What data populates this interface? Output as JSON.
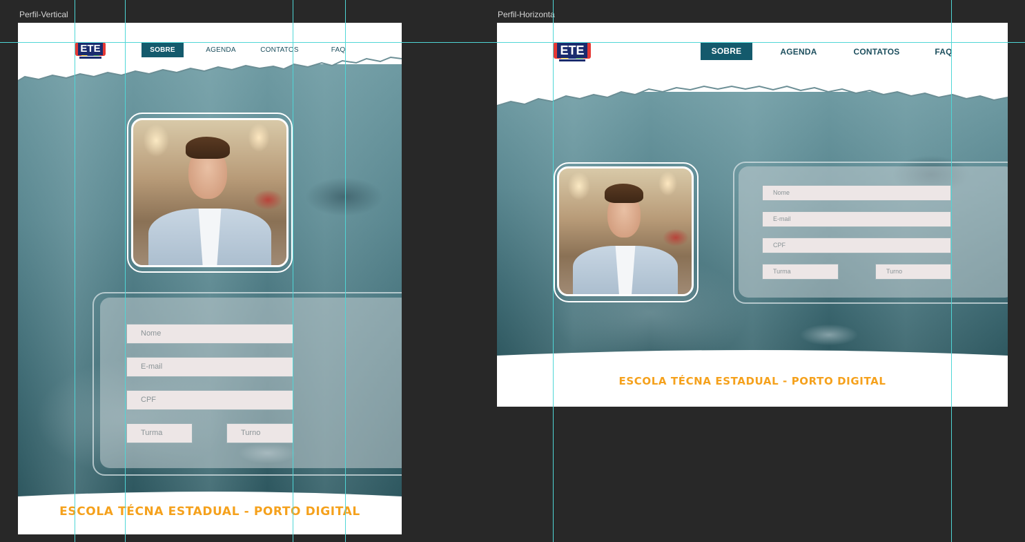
{
  "artboards": {
    "vertical": {
      "name": "Perfil-Vertical"
    },
    "horizontal": {
      "name": "Perfil-Horizonta"
    }
  },
  "logo": {
    "text": "ETE"
  },
  "nav": [
    {
      "label": "SOBRE",
      "active": true
    },
    {
      "label": "AGENDA",
      "active": false
    },
    {
      "label": "CONTATOS",
      "active": false
    },
    {
      "label": "FAQ",
      "active": false
    }
  ],
  "form": {
    "name_placeholder": "Nome",
    "email_placeholder": "E-mail",
    "cpf_placeholder": "CPF",
    "class_placeholder": "Turma",
    "shift_placeholder": "Turno"
  },
  "footer": {
    "title": "ESCOLA TÉCNA ESTADUAL - PORTO DIGITAL"
  },
  "colors": {
    "nav_active_bg": "#145a6c",
    "nav_text": "#1d4f5e",
    "footer_accent": "#f5a11c",
    "guide": "#4fd6d6",
    "workspace": "#282828"
  },
  "icons": [
    "ete-logo",
    "profile-photo"
  ]
}
